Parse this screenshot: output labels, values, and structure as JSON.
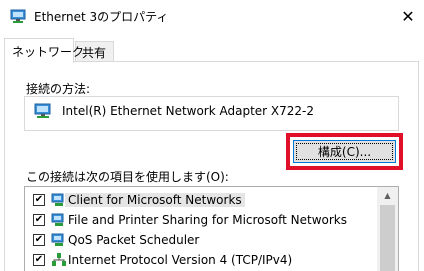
{
  "window": {
    "title": "Ethernet 3のプロパティ",
    "close_label": "✕"
  },
  "tabs": [
    {
      "label": "ネットワーク",
      "active": true
    },
    {
      "label": "共有",
      "active": false
    }
  ],
  "connection": {
    "label": "接続の方法:",
    "adapter": "Intel(R) Ethernet Network Adapter X722-2",
    "configure_button": "構成(C)..."
  },
  "items_section": {
    "label": "この接続は次の項目を使用します(O):",
    "items": [
      {
        "label": "Client for Microsoft Networks",
        "checked": true,
        "icon": "network-client-icon",
        "selected": true
      },
      {
        "label": "File and Printer Sharing for Microsoft Networks",
        "checked": true,
        "icon": "network-service-icon",
        "selected": false
      },
      {
        "label": "QoS Packet Scheduler",
        "checked": true,
        "icon": "network-service-icon",
        "selected": false
      },
      {
        "label": "Internet Protocol Version 4 (TCP/IPv4)",
        "checked": true,
        "icon": "protocol-icon",
        "selected": false
      }
    ]
  },
  "colors": {
    "highlight_border": "#e0102a",
    "button_focus": "#0078d7"
  }
}
